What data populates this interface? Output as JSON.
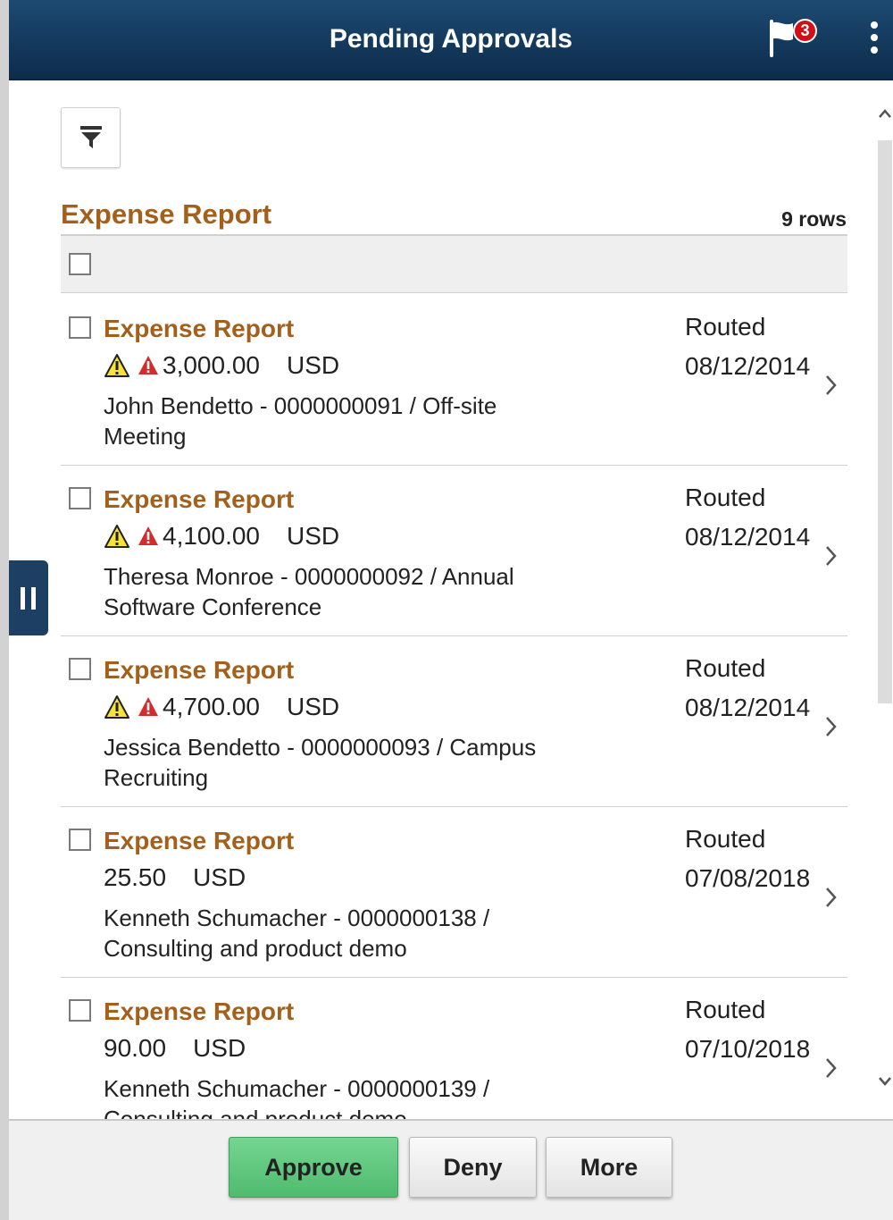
{
  "header": {
    "title": "Pending Approvals",
    "notification_count": "3"
  },
  "section": {
    "title": "Expense Report",
    "row_count": "9 rows"
  },
  "items": [
    {
      "title": "Expense Report",
      "amount": "3,000.00",
      "currency": "USD",
      "has_warnings": true,
      "description": "John Bendetto - 0000000091 / Off-site Meeting",
      "status": "Routed",
      "date": "08/12/2014"
    },
    {
      "title": "Expense Report",
      "amount": "4,100.00",
      "currency": "USD",
      "has_warnings": true,
      "description": "Theresa Monroe - 0000000092 / Annual Software Conference",
      "status": "Routed",
      "date": "08/12/2014"
    },
    {
      "title": "Expense Report",
      "amount": "4,700.00",
      "currency": "USD",
      "has_warnings": true,
      "description": "Jessica Bendetto - 0000000093 / Campus Recruiting",
      "status": "Routed",
      "date": "08/12/2014"
    },
    {
      "title": "Expense Report",
      "amount": "25.50",
      "currency": "USD",
      "has_warnings": false,
      "description": "Kenneth Schumacher - 0000000138 / Consulting and product demo",
      "status": "Routed",
      "date": "07/08/2018"
    },
    {
      "title": "Expense Report",
      "amount": "90.00",
      "currency": "USD",
      "has_warnings": false,
      "description": "Kenneth Schumacher - 0000000139 / Consulting and product demo",
      "status": "Routed",
      "date": "07/10/2018"
    }
  ],
  "footer": {
    "approve_label": "Approve",
    "deny_label": "Deny",
    "more_label": "More"
  },
  "colors": {
    "header_bg": "#0d2c4b",
    "accent_title": "#a35f1c",
    "approve_green": "#4fbb6e",
    "badge_red": "#d10f17"
  }
}
